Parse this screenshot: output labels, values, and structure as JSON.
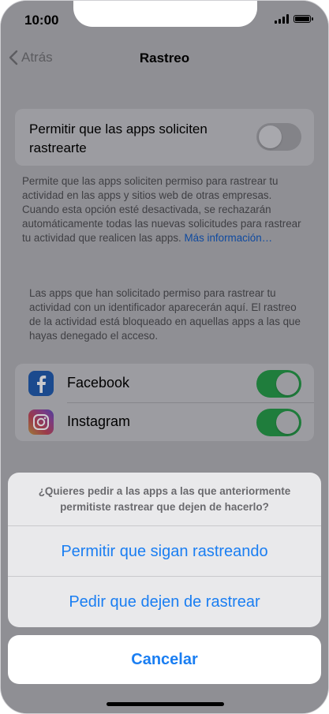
{
  "status_bar": {
    "time": "10:00"
  },
  "nav": {
    "back_label": "Atrás",
    "title": "Rastreo"
  },
  "tracking_setting": {
    "label": "Permitir que las apps soliciten rastrearte",
    "enabled": false
  },
  "description": {
    "text": "Permite que las apps soliciten permiso para rastrear tu actividad en las apps y sitios web de otras empresas. Cuando esta opción esté desactivada, se rechazarán automáticamente todas las nuevas solicitudes para rastrear tu actividad que realicen las apps.",
    "link": "Más información…"
  },
  "apps_description": "Las apps que han solicitado permiso para rastrear tu actividad con un identificador aparecerán aquí. El rastreo de la actividad está bloqueado en aquellas apps a las que hayas denegado el acceso.",
  "apps": [
    {
      "name": "Facebook",
      "icon": "facebook-icon",
      "enabled": true
    },
    {
      "name": "Instagram",
      "icon": "instagram-icon",
      "enabled": true
    }
  ],
  "action_sheet": {
    "message": "¿Quieres pedir a las apps a las que anteriormente permitiste rastrear que dejen de hacerlo?",
    "options": [
      "Permitir que sigan rastreando",
      "Pedir que dejen de rastrear"
    ],
    "cancel": "Cancelar"
  },
  "colors": {
    "accent": "#1a7ef2",
    "toggle_on": "#34c759"
  }
}
